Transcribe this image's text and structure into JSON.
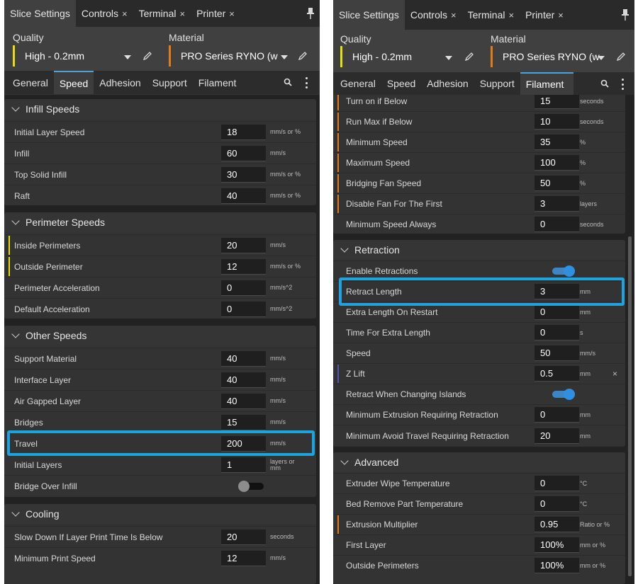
{
  "colors": {
    "accent": "#1ea3e0",
    "quality_marker": "#e8e000",
    "material_marker": "#e07c1a",
    "toggle_on": "#2f8fe0"
  },
  "left": {
    "tabs": [
      {
        "label": "Slice Settings",
        "closable": false
      },
      {
        "label": "Controls",
        "closable": true,
        "close": "×"
      },
      {
        "label": "Terminal",
        "closable": true,
        "close": "×"
      },
      {
        "label": "Printer",
        "closable": true,
        "close": "×"
      }
    ],
    "quality_label": "Quality",
    "quality_value": "High - 0.2mm",
    "material_label": "Material",
    "material_value": "PRO Series RYNO (w",
    "subtabs": [
      "General",
      "Speed",
      "Adhesion",
      "Support",
      "Filament"
    ],
    "active_subtab": "Speed",
    "groups": {
      "infill": {
        "title": "Infill Speeds",
        "rows": [
          {
            "label": "Initial Layer Speed",
            "value": "18",
            "unit": "mm/s or %"
          },
          {
            "label": "Infill",
            "value": "60",
            "unit": "mm/s"
          },
          {
            "label": "Top Solid Infill",
            "value": "30",
            "unit": "mm/s or %"
          },
          {
            "label": "Raft",
            "value": "40",
            "unit": "mm/s or %"
          }
        ]
      },
      "perimeter": {
        "title": "Perimeter Speeds",
        "rows": [
          {
            "label": "Inside Perimeters",
            "value": "20",
            "unit": "mm/s"
          },
          {
            "label": "Outside Perimeter",
            "value": "12",
            "unit": "mm/s or %"
          },
          {
            "label": "Perimeter Acceleration",
            "value": "0",
            "unit": "mm/s^2"
          },
          {
            "label": "Default Acceleration",
            "value": "0",
            "unit": "mm/s^2"
          }
        ]
      },
      "other": {
        "title": "Other Speeds",
        "rows": [
          {
            "label": "Support Material",
            "value": "40",
            "unit": "mm/s"
          },
          {
            "label": "Interface Layer",
            "value": "40",
            "unit": "mm/s"
          },
          {
            "label": "Air Gapped Layer",
            "value": "40",
            "unit": "mm/s"
          },
          {
            "label": "Bridges",
            "value": "15",
            "unit": "mm/s"
          },
          {
            "label": "Travel",
            "value": "200",
            "unit": "mm/s"
          },
          {
            "label": "Initial Layers",
            "value": "1",
            "unit": "layers or mm"
          },
          {
            "label": "Bridge Over Infill",
            "toggle": false
          }
        ]
      },
      "cooling": {
        "title": "Cooling",
        "rows": [
          {
            "label": "Slow Down If Layer Print Time Is Below",
            "value": "20",
            "unit": "seconds"
          },
          {
            "label": "Minimum Print Speed",
            "value": "12",
            "unit": "mm/s"
          }
        ]
      }
    }
  },
  "right": {
    "tabs": [
      {
        "label": "Slice Settings",
        "closable": false
      },
      {
        "label": "Controls",
        "closable": true,
        "close": "×"
      },
      {
        "label": "Terminal",
        "closable": true,
        "close": "×"
      },
      {
        "label": "Printer",
        "closable": true,
        "close": "×"
      }
    ],
    "quality_label": "Quality",
    "quality_value": "High - 0.2mm",
    "material_label": "Material",
    "material_value": "PRO Series RYNO (w",
    "subtabs": [
      "General",
      "Speed",
      "Adhesion",
      "Support",
      "Filament"
    ],
    "active_subtab": "Filament",
    "groups": {
      "fan": {
        "rows": [
          {
            "label": "Turn on if Below",
            "value": "15",
            "unit": "seconds"
          },
          {
            "label": "Run Max if Below",
            "value": "10",
            "unit": "seconds"
          },
          {
            "label": "Minimum Speed",
            "value": "35",
            "unit": "%"
          },
          {
            "label": "Maximum Speed",
            "value": "100",
            "unit": "%"
          },
          {
            "label": "Bridging Fan Speed",
            "value": "50",
            "unit": "%"
          },
          {
            "label": "Disable Fan For The First",
            "value": "3",
            "unit": "layers"
          },
          {
            "label": "Minimum Speed Always",
            "value": "0",
            "unit": "seconds"
          }
        ]
      },
      "retraction": {
        "title": "Retraction",
        "rows": [
          {
            "label": "Enable Retractions",
            "toggle": true
          },
          {
            "label": "Retract Length",
            "value": "3",
            "unit": "mm"
          },
          {
            "label": "Extra Length On Restart",
            "value": "0",
            "unit": "mm"
          },
          {
            "label": "Time For Extra Length",
            "value": "0",
            "unit": "s"
          },
          {
            "label": "Speed",
            "value": "50",
            "unit": "mm/s"
          },
          {
            "label": "Z Lift",
            "value": "0.5",
            "unit": "mm",
            "clear": "×"
          },
          {
            "label": "Retract When Changing Islands",
            "toggle": true
          },
          {
            "label": "Minimum Extrusion Requiring Retraction",
            "value": "0",
            "unit": "mm"
          },
          {
            "label": "Minimum Avoid Travel Requiring Retraction",
            "value": "20",
            "unit": "mm"
          }
        ]
      },
      "advanced": {
        "title": "Advanced",
        "rows": [
          {
            "label": "Extruder Wipe Temperature",
            "value": "0",
            "unit": "°C"
          },
          {
            "label": "Bed Remove Part Temperature",
            "value": "0",
            "unit": "°C"
          },
          {
            "label": "Extrusion Multiplier",
            "value": "0.95",
            "unit": "Ratio or %"
          },
          {
            "label": "First Layer",
            "value": "100%",
            "unit": "mm or %"
          },
          {
            "label": "Outside Perimeters",
            "value": "100%",
            "unit": "mm or %"
          }
        ]
      }
    }
  }
}
